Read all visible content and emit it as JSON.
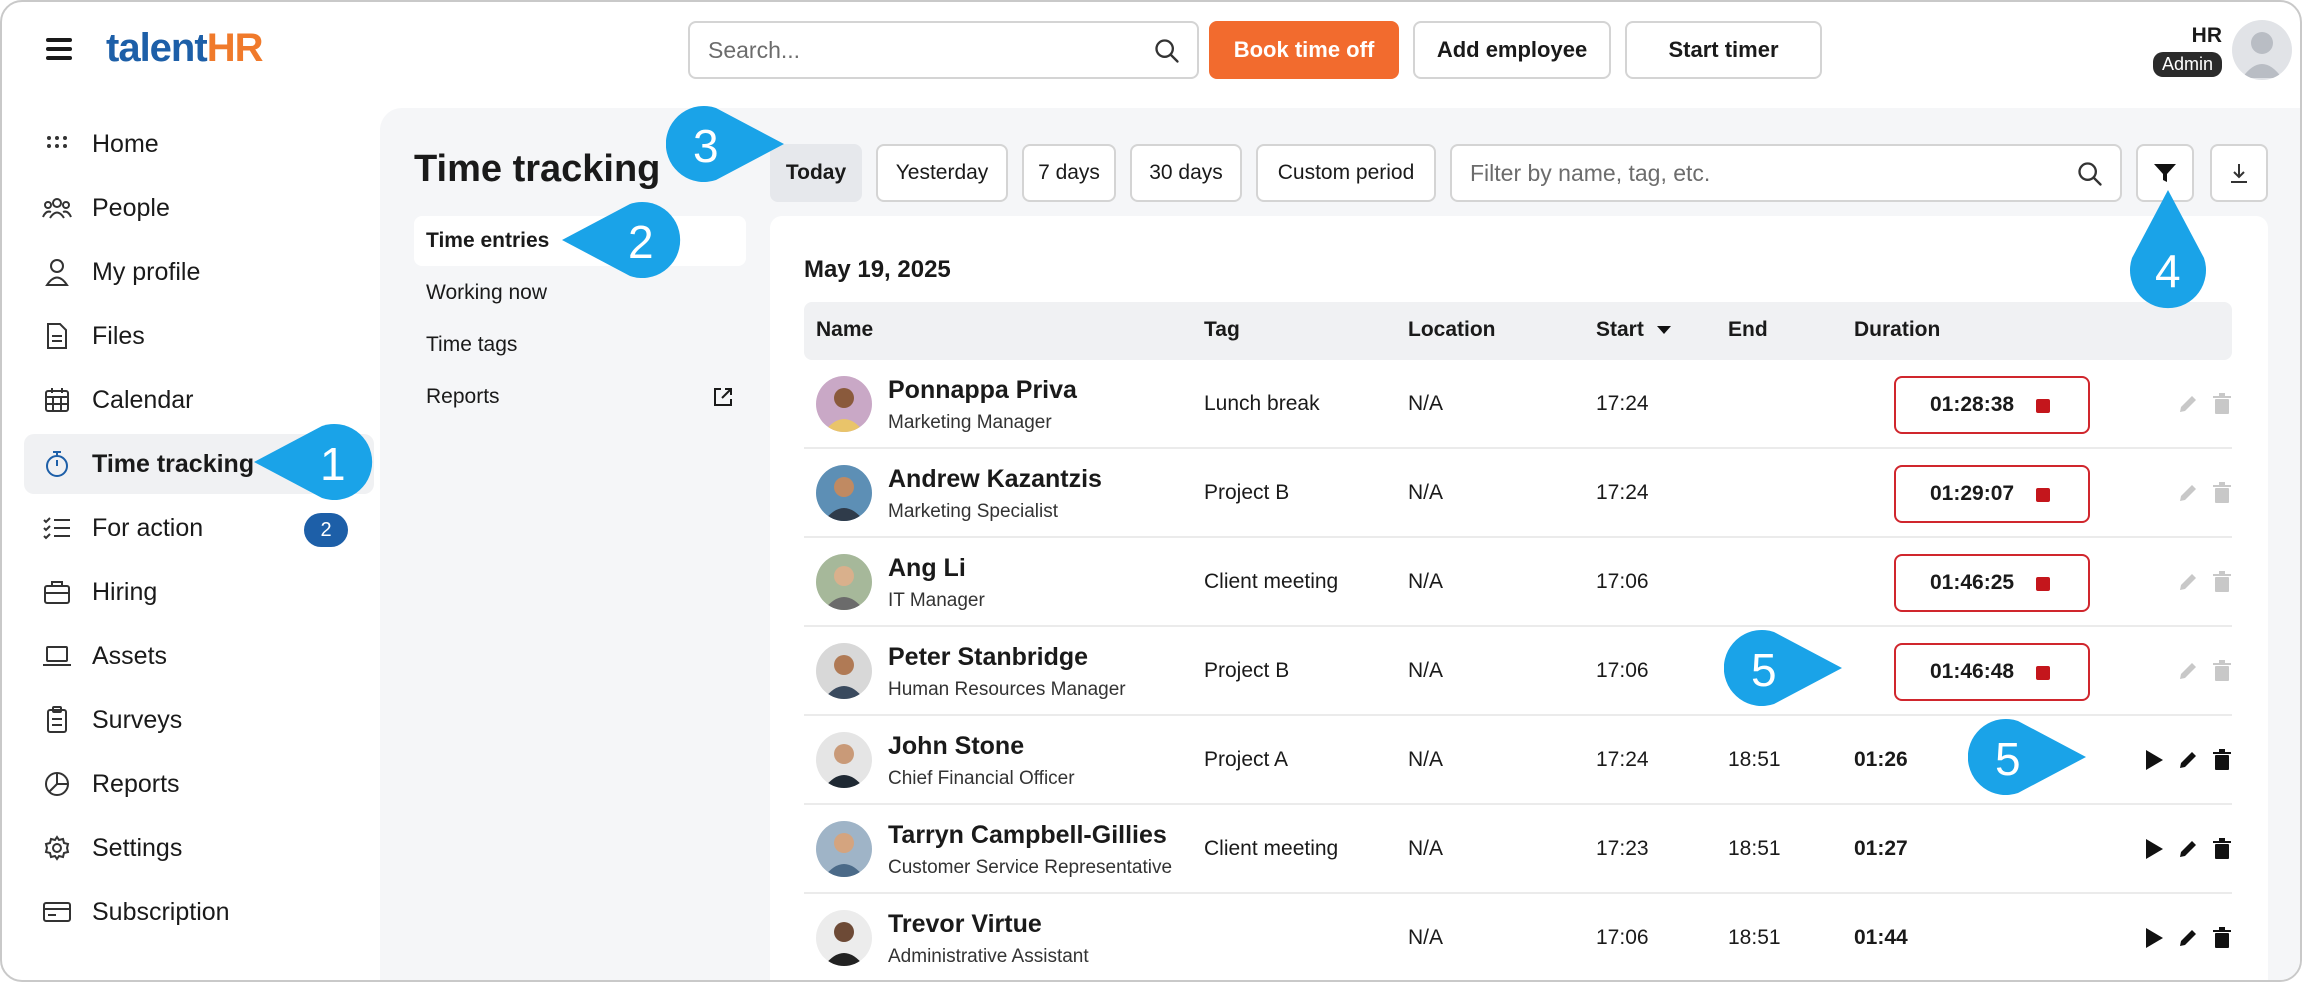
{
  "app": {
    "logo_part1": "talent",
    "logo_part2": "HR"
  },
  "header": {
    "search_placeholder": "Search...",
    "book_time_off": "Book time off",
    "add_employee": "Add employee",
    "start_timer": "Start timer",
    "user_initials": "HR",
    "user_role": "Admin"
  },
  "sidebar": {
    "items": [
      {
        "label": "Home",
        "icon": "grid-icon"
      },
      {
        "label": "People",
        "icon": "people-icon"
      },
      {
        "label": "My profile",
        "icon": "person-icon"
      },
      {
        "label": "Files",
        "icon": "file-icon"
      },
      {
        "label": "Calendar",
        "icon": "calendar-icon"
      },
      {
        "label": "Time tracking",
        "icon": "stopwatch-icon"
      },
      {
        "label": "For action",
        "icon": "checklist-icon",
        "badge": "2"
      },
      {
        "label": "Hiring",
        "icon": "briefcase-icon"
      },
      {
        "label": "Assets",
        "icon": "laptop-icon"
      },
      {
        "label": "Surveys",
        "icon": "clipboard-icon"
      },
      {
        "label": "Reports",
        "icon": "pie-chart-icon"
      },
      {
        "label": "Settings",
        "icon": "gear-icon"
      },
      {
        "label": "Subscription",
        "icon": "card-icon"
      }
    ]
  },
  "page": {
    "title": "Time tracking",
    "subnav": [
      "Time entries",
      "Working now",
      "Time tags",
      "Reports"
    ],
    "periods": [
      "Today",
      "Yesterday",
      "7 days",
      "30 days",
      "Custom period"
    ],
    "filter_placeholder": "Filter by name, tag, etc.",
    "date": "May 19, 2025",
    "columns": {
      "name": "Name",
      "tag": "Tag",
      "location": "Location",
      "start": "Start",
      "end": "End",
      "duration": "Duration"
    }
  },
  "entries": [
    {
      "name": "Ponnappa Priva",
      "role": "Marketing Manager",
      "tag": "Lunch break",
      "location": "N/A",
      "start": "17:24",
      "end": "",
      "duration": "01:28:38",
      "running": true
    },
    {
      "name": "Andrew Kazantzis",
      "role": "Marketing Specialist",
      "tag": "Project B",
      "location": "N/A",
      "start": "17:24",
      "end": "",
      "duration": "01:29:07",
      "running": true
    },
    {
      "name": "Ang Li",
      "role": "IT Manager",
      "tag": "Client meeting",
      "location": "N/A",
      "start": "17:06",
      "end": "",
      "duration": "01:46:25",
      "running": true
    },
    {
      "name": "Peter Stanbridge",
      "role": "Human Resources Manager",
      "tag": "Project B",
      "location": "N/A",
      "start": "17:06",
      "end": "",
      "duration": "01:46:48",
      "running": true
    },
    {
      "name": "John Stone",
      "role": "Chief Financial Officer",
      "tag": "Project A",
      "location": "N/A",
      "start": "17:24",
      "end": "18:51",
      "duration": "01:26",
      "running": false
    },
    {
      "name": "Tarryn Campbell-Gillies",
      "role": "Customer Service Representative",
      "tag": "Client meeting",
      "location": "N/A",
      "start": "17:23",
      "end": "18:51",
      "duration": "01:27",
      "running": false
    },
    {
      "name": "Trevor Virtue",
      "role": "Administrative Assistant",
      "tag": "",
      "location": "N/A",
      "start": "17:06",
      "end": "18:51",
      "duration": "01:44",
      "running": false
    }
  ],
  "callouts": [
    "1",
    "2",
    "3",
    "4",
    "5",
    "5"
  ],
  "colors": {
    "accent_orange": "#f26b2e",
    "brand_blue": "#1d5fa8",
    "callout_blue": "#1aa3e8",
    "stop_red": "#c4161c"
  }
}
